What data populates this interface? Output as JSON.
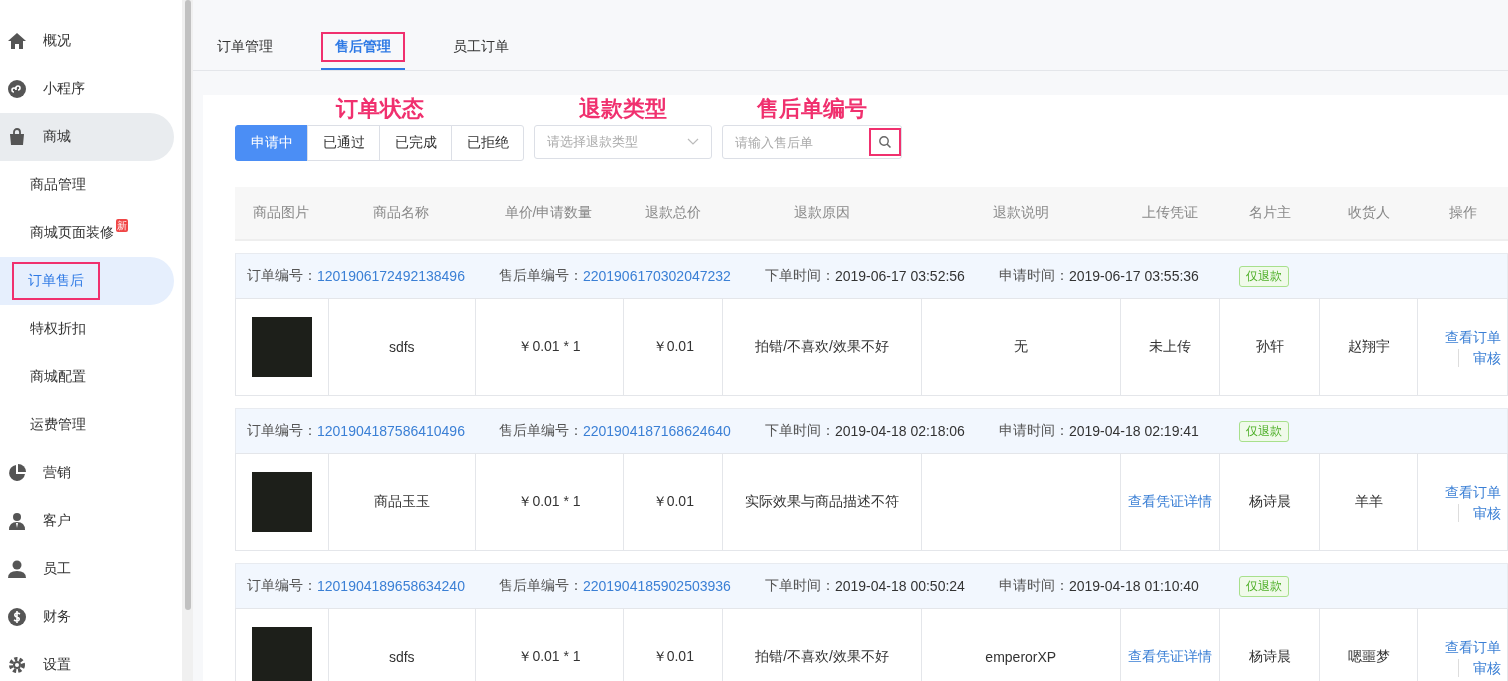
{
  "sidebar": {
    "items": [
      {
        "label": "概况",
        "selected": false
      },
      {
        "label": "小程序",
        "selected": false
      },
      {
        "label": "商城",
        "selected": false,
        "expanded": true,
        "children": [
          {
            "label": "商品管理",
            "selected": false,
            "highlighted": false
          },
          {
            "label": "商城页面装修",
            "selected": false,
            "highlighted": false,
            "badge": "新"
          },
          {
            "label": "订单售后",
            "selected": true,
            "highlighted": true
          },
          {
            "label": "特权折扣",
            "selected": false,
            "highlighted": false
          },
          {
            "label": "商城配置",
            "selected": false,
            "highlighted": false
          },
          {
            "label": "运费管理",
            "selected": false,
            "highlighted": false
          }
        ]
      },
      {
        "label": "营销",
        "selected": false
      },
      {
        "label": "客户",
        "selected": false
      },
      {
        "label": "员工",
        "selected": false
      },
      {
        "label": "财务",
        "selected": false
      },
      {
        "label": "设置",
        "selected": false
      }
    ]
  },
  "tabs": [
    {
      "label": "订单管理",
      "selected": false,
      "highlighted": false
    },
    {
      "label": "售后管理",
      "selected": true,
      "highlighted": true
    },
    {
      "label": "员工订单",
      "selected": false,
      "highlighted": false
    }
  ],
  "filters": {
    "status": {
      "annotation": "订单状态",
      "options": [
        {
          "label": "申请中",
          "selected": true
        },
        {
          "label": "已通过",
          "selected": false
        },
        {
          "label": "已完成",
          "selected": false
        },
        {
          "label": "已拒绝",
          "selected": false
        }
      ]
    },
    "refund_type": {
      "annotation": "退款类型",
      "placeholder": "请选择退款类型"
    },
    "search": {
      "annotation": "售后单编号",
      "placeholder": "请输入售后单",
      "button_highlighted": true
    }
  },
  "table": {
    "columns": [
      "商品图片",
      "商品名称",
      "单价/申请数量",
      "退款总价",
      "退款原因",
      "退款说明",
      "上传凭证",
      "名片主",
      "收货人",
      "操作"
    ],
    "orders": [
      {
        "order_label": "订单编号：",
        "order_no": "1201906172492138496",
        "after_label": "售后单编号：",
        "after_no": "2201906170302047232",
        "placed_label": "下单时间：",
        "placed": "2019-06-17 03:52:56",
        "applied_label": "申请时间：",
        "applied": "2019-06-17 03:55:36",
        "tag": "仅退款",
        "name": "sdfs",
        "price": "￥0.01 * 1",
        "total": "￥0.01",
        "reason": "拍错/不喜欢/效果不好",
        "description": "无",
        "voucher": {
          "text": "未上传",
          "link": false
        },
        "owner": "孙轩",
        "receiver": "赵翔宇",
        "actions": [
          "查看订单",
          "审核"
        ]
      },
      {
        "order_label": "订单编号：",
        "order_no": "1201904187586410496",
        "after_label": "售后单编号：",
        "after_no": "2201904187168624640",
        "placed_label": "下单时间：",
        "placed": "2019-04-18 02:18:06",
        "applied_label": "申请时间：",
        "applied": "2019-04-18 02:19:41",
        "tag": "仅退款",
        "name": "商品玉玉",
        "price": "￥0.01 * 1",
        "total": "￥0.01",
        "reason": "实际效果与商品描述不符",
        "voucher": {
          "text": "查看凭证详情",
          "link": true
        },
        "owner": "杨诗晨",
        "receiver": "羊羊",
        "actions": [
          "查看订单",
          "审核"
        ]
      },
      {
        "order_label": "订单编号：",
        "order_no": "1201904189658634240",
        "after_label": "售后单编号：",
        "after_no": "2201904185902503936",
        "placed_label": "下单时间：",
        "placed": "2019-04-18 00:50:24",
        "applied_label": "申请时间：",
        "applied": "2019-04-18 01:10:40",
        "tag": "仅退款",
        "name": "sdfs",
        "price": "￥0.01 * 1",
        "total": "￥0.01",
        "reason": "拍错/不喜欢/效果不好",
        "description": "emperorXP",
        "voucher": {
          "text": "查看凭证详情",
          "link": true
        },
        "owner": "杨诗晨",
        "receiver": "嗯噩梦",
        "actions": [
          "查看订单",
          "审核"
        ]
      }
    ]
  }
}
